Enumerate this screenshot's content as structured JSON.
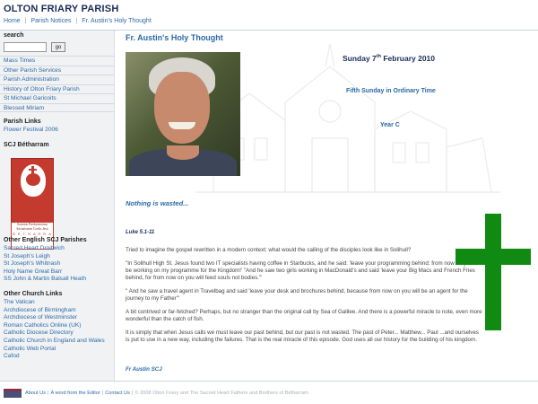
{
  "site": {
    "title": "OLTON FRIARY PARISH"
  },
  "topnav": {
    "items": [
      "Home",
      "Parish Notices",
      "Fr. Austin's Holy Thought"
    ],
    "separator": "|"
  },
  "sidebar": {
    "search_heading": "search",
    "search_value": "",
    "search_button": "go",
    "menu": [
      "Mass Times",
      "Other Parish Services",
      "Parish Administration",
      "History of Olton Friary Parish",
      "St Michael Garicoits",
      "Blessed Miriam"
    ],
    "parish_links_heading": "Parish Links",
    "parish_links": [
      "Flower Festival 2006"
    ],
    "scj_heading": "SCJ Bétharram",
    "scj_logo_caption_1": "Societas Presbyterorum",
    "scj_logo_caption_2": "Sacratissimi Cordis Jesu",
    "scj_logo_caption_3": "B E T H A R R A M",
    "other_scj_heading": "Other English SCJ Parishes",
    "other_scj": [
      "Sacred Heart Droitwich",
      "St Joseph's Leigh",
      "St Joseph's Whitnash",
      "Holy Name Great Barr",
      "SS John & Martin Balsall Heath"
    ],
    "other_church_heading": "Other Church Links",
    "other_church": [
      "The Vatican",
      "Archdiocese of Birmingham",
      "Archdiocese of Westminster",
      "Roman Catholics Online (UK)",
      "Catholic Diocese Directory",
      "Catholic Church in England and Wales",
      "Catholic Web Portal",
      "Cafod"
    ]
  },
  "main": {
    "heading": "Fr. Austin's Holy Thought",
    "date_prefix": "Sunday 7",
    "date_sup": "th",
    "date_suffix": " February 2010",
    "sunday": "Fifth Sunday in Ordinary Time",
    "year": "Year C",
    "subtitle": "Nothing is wasted...",
    "reference": "Luke 5.1-11",
    "paragraphs": [
      "Tried to imagine the gospel rewritten in a modern context: what would the calling of the disciples look like in Solihull?",
      "\"In Solihull High St. Jesus found two IT specialists having coffee in Starbucks, and he said: 'leave your programming behind: from now on you'll be working on my programme for the Kingdom!' \"And he saw two girls working in MacDonald's and said 'leave your Big Macs and French Fries behind, for from now on you will feed souls not bodies.'\"",
      "\" And he saw a travel agent in Travelbag and said 'leave your desk and brochures behind, because from now on you will be an agent for the journey to my Father'\"",
      "A bit contrived or far-fetched? Perhaps, but no stranger than the original call by Sea of Galilee. And there is a powerful miracle to note, even more wonderful than the catch of fish.",
      "It is simply that when Jesus calls we must leave our past behind, but our past is not wasted. The past of Peter... Matthew... Paul ...and ourselves is put to use in a new way, including the failures. That is the real miracle of this episode. God uses all our history for the building of his kingdom."
    ],
    "signature": "Fr Austin SCJ"
  },
  "footer": {
    "links": [
      "About Us",
      "A word from the Editor",
      "Contact Us"
    ],
    "copyright": "© 2008 Olton Friary and The Sacred Heart Fathers and Brothers of Bétharram"
  },
  "colors": {
    "link": "#2b6aa6",
    "title": "#1a2c5a",
    "cross": "#108a12",
    "sidebar_bg": "#f1f2f4"
  }
}
